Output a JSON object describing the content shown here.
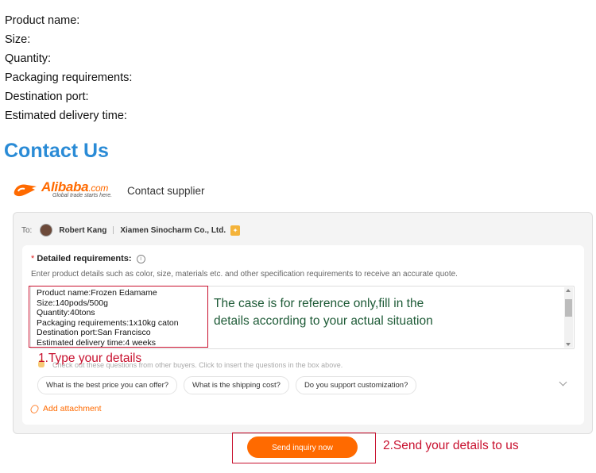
{
  "spec_fields": [
    "Product name:",
    "Size:",
    "Quantity:",
    "Packaging requirements:",
    "Destination port:",
    "Estimated delivery time:"
  ],
  "contact_title": "Contact Us",
  "alibaba": {
    "logo_word": "Alibaba",
    "logo_suffix": ".com",
    "logo_tagline": "Global trade starts here.",
    "contact_supplier": "Contact supplier"
  },
  "inquiry": {
    "to_label": "To:",
    "recipient_name": "Robert Kang",
    "company": "Xiamen Sinocharm Co., Ltd.",
    "required_mark": "*",
    "requirements_title": "Detailed requirements:",
    "requirements_hint": "Enter product details such as color, size, materials etc. and other specification requirements to receive an accurate quote.",
    "details_lines": [
      "Product name:Frozen Edamame",
      "Size:140pods/500g",
      "Quantity:40tons",
      "Packaging requirements:1x10kg caton",
      "Destination port:San Francisco",
      "Estimated delivery time:4 weeks"
    ],
    "note_text": "The case is for reference only,fill in the details according to your actual situation",
    "suggest_hint": "Check out these questions from other buyers. Click to insert the questions in the box above.",
    "suggested_questions": [
      "What is the best price you can offer?",
      "What is the shipping cost?",
      "Do you support customization?"
    ],
    "add_attachment": "Add attachment",
    "send_button": "Send inquiry now"
  },
  "annotations": {
    "step1": "1.Type your details",
    "step2": "2.Send your details to us"
  },
  "colors": {
    "accent_orange": "#ff6a00",
    "title_blue": "#2a8bd6",
    "annotation_red": "#c8102e",
    "note_green": "#1d5a36"
  }
}
